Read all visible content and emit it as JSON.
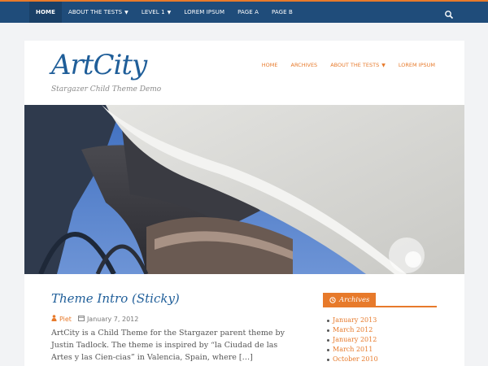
{
  "topnav": {
    "items": [
      {
        "label": "HOME",
        "active": true
      },
      {
        "label": "ABOUT THE TESTS",
        "dropdown": true
      },
      {
        "label": "LEVEL 1",
        "dropdown": true
      },
      {
        "label": "LOREM IPSUM"
      },
      {
        "label": "PAGE A"
      },
      {
        "label": "PAGE B"
      }
    ],
    "search_icon": "search-icon"
  },
  "site": {
    "title": "ArtCity",
    "tagline": "Stargazer Child Theme Demo"
  },
  "mainnav": {
    "items": [
      {
        "label": "HOME"
      },
      {
        "label": "ARCHIVES"
      },
      {
        "label": "ABOUT THE TESTS",
        "dropdown": true
      },
      {
        "label": "LOREM IPSUM"
      }
    ]
  },
  "post": {
    "title": "Theme Intro (Sticky)",
    "author": "Piet",
    "date": "January 7, 2012",
    "excerpt": "ArtCity is a Child Theme for the Stargazer parent theme by Justin Tadlock. The theme is inspired by “la Ciudad de las Artes y las Cien-cias” in Valencia, Spain, where […]"
  },
  "sidebar": {
    "widget_title": "Archives",
    "archives": [
      "January 2013",
      "March 2012",
      "January 2012",
      "March 2011",
      "October 2010"
    ]
  },
  "colors": {
    "topbar": "#1f4c7a",
    "accent": "#e77a2b",
    "link": "#1f5e99",
    "background": "#f2f3f5"
  }
}
